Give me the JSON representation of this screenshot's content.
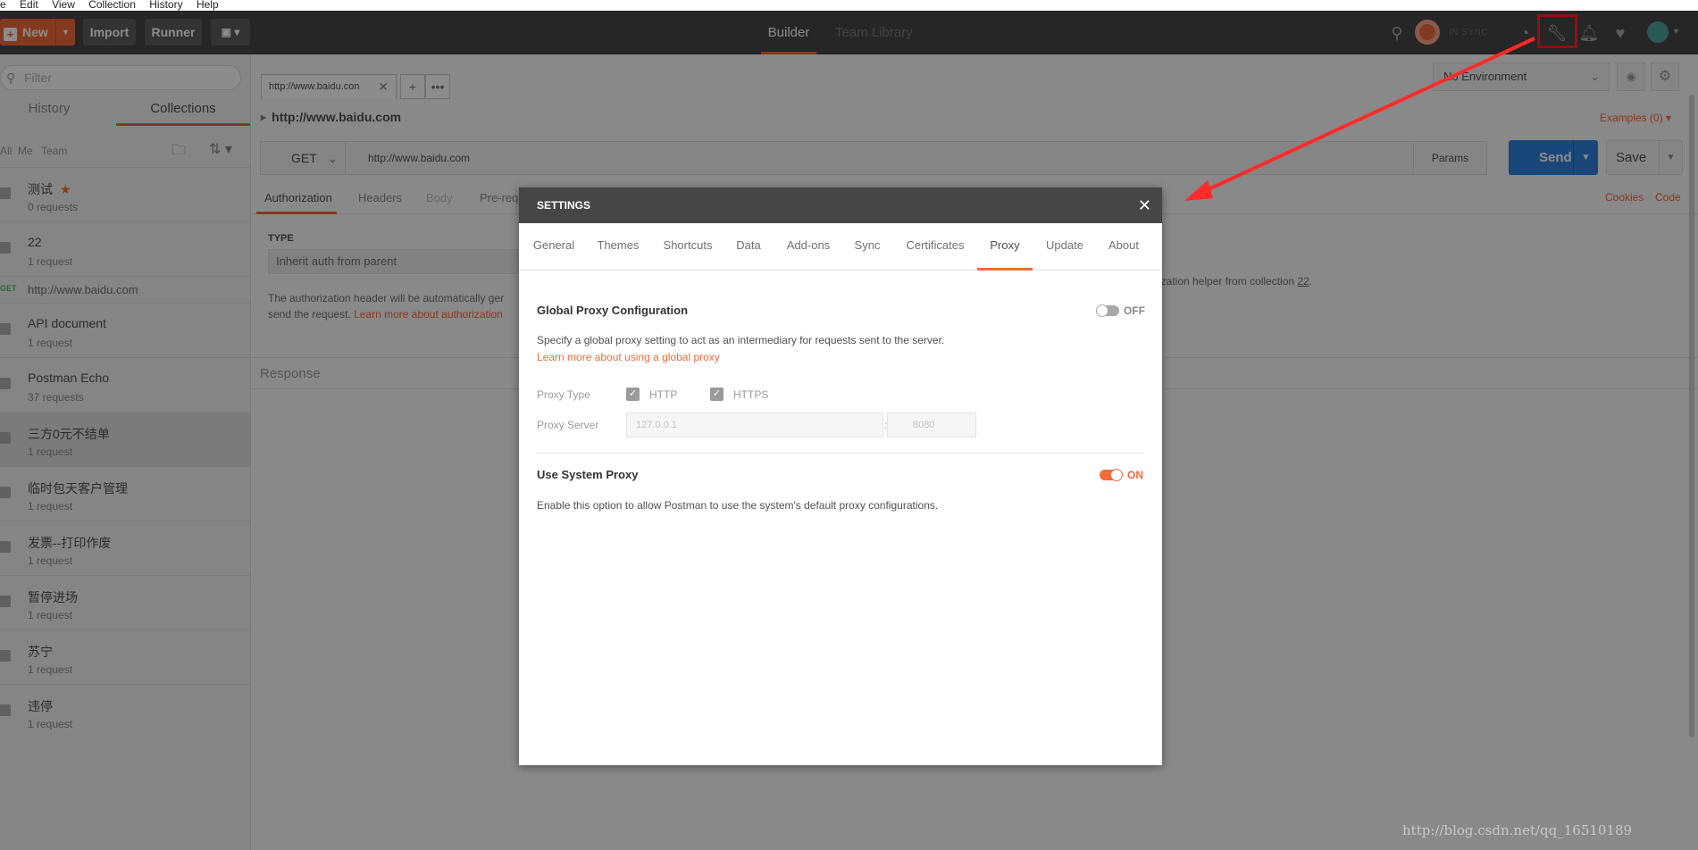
{
  "menubar": [
    "e",
    "Edit",
    "View",
    "Collection",
    "History",
    "Help"
  ],
  "header": {
    "new_label": "New",
    "import_label": "Import",
    "runner_label": "Runner",
    "tabs": [
      "Builder",
      "Team Library"
    ],
    "sync_status": "IN SYNC",
    "accent_color": "#f26b3a"
  },
  "sidebar": {
    "filter_placeholder": "Filter",
    "tabs": [
      "History",
      "Collections"
    ],
    "sub_filters": [
      "All",
      "Me",
      "Team"
    ],
    "collections": [
      {
        "name": "测试",
        "count": "0 requests",
        "starred": true
      },
      {
        "name": "22",
        "count": "1 request"
      },
      {
        "name": "API document",
        "count": "1 request"
      },
      {
        "name": "Postman Echo",
        "count": "37 requests"
      },
      {
        "name": "三方0元不结单",
        "count": "1 request",
        "selected": true
      },
      {
        "name": "临时包天客户管理",
        "count": "1 request"
      },
      {
        "name": "发票--打印作废",
        "count": "1 request"
      },
      {
        "name": "暂停进场",
        "count": "1 request"
      },
      {
        "name": "苏宁",
        "count": "1 request"
      },
      {
        "name": "违停",
        "count": "1 request"
      }
    ],
    "request": {
      "method": "GET",
      "url": "http://www.baidu.com"
    }
  },
  "main": {
    "tab_label": "http://www.baidu.con",
    "environment": "No Environment",
    "request_title": "http://www.baidu.com",
    "examples": "Examples (0)",
    "method": "GET",
    "url": "http://www.baidu.com",
    "params": "Params",
    "send": "Send",
    "save": "Save",
    "subtabs": [
      "Authorization",
      "Headers",
      "Body",
      "Pre-req"
    ],
    "cookies": "Cookies",
    "code": "Code",
    "type_label": "TYPE",
    "type_value": "Inherit auth from parent",
    "auth_text_1": "The authorization header will be automatically ger",
    "auth_text_2": "send the request. ",
    "auth_link": "Learn more about authorization",
    "auth_right": "ization helper from collection ",
    "auth_right_link": "22",
    "response": "Response"
  },
  "settings": {
    "title": "SETTINGS",
    "tabs": [
      "General",
      "Themes",
      "Shortcuts",
      "Data",
      "Add-ons",
      "Sync",
      "Certificates",
      "Proxy",
      "Update",
      "About"
    ],
    "active_tab": "Proxy",
    "global_proxy": {
      "title": "Global Proxy Configuration",
      "toggle": "OFF",
      "description": "Specify a global proxy setting to act as an intermediary for requests sent to the server.",
      "link": "Learn more about using a global proxy",
      "proxy_type_label": "Proxy Type",
      "http_label": "HTTP",
      "https_label": "HTTPS",
      "proxy_server_label": "Proxy Server",
      "server_placeholder": "127.0.0.1",
      "port_placeholder": "8080",
      "colon": ":"
    },
    "system_proxy": {
      "title": "Use System Proxy",
      "toggle": "ON",
      "description": "Enable this option to allow Postman to use the system's default proxy configurations."
    }
  },
  "watermark": "http://blog.csdn.net/qq_16510189"
}
